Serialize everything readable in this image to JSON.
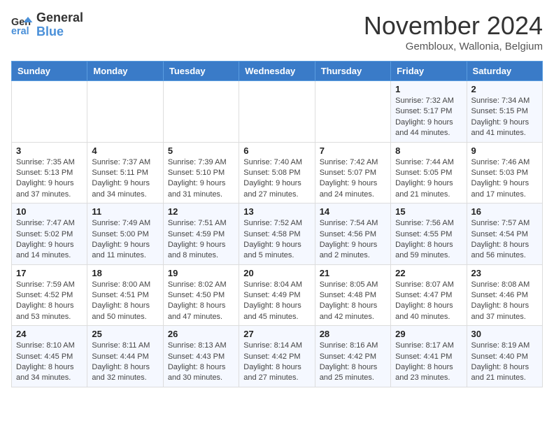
{
  "logo": {
    "text_general": "General",
    "text_blue": "Blue"
  },
  "header": {
    "month_year": "November 2024",
    "location": "Gembloux, Wallonia, Belgium"
  },
  "weekdays": [
    "Sunday",
    "Monday",
    "Tuesday",
    "Wednesday",
    "Thursday",
    "Friday",
    "Saturday"
  ],
  "weeks": [
    [
      {
        "day": "",
        "info": ""
      },
      {
        "day": "",
        "info": ""
      },
      {
        "day": "",
        "info": ""
      },
      {
        "day": "",
        "info": ""
      },
      {
        "day": "",
        "info": ""
      },
      {
        "day": "1",
        "info": "Sunrise: 7:32 AM\nSunset: 5:17 PM\nDaylight: 9 hours\nand 44 minutes."
      },
      {
        "day": "2",
        "info": "Sunrise: 7:34 AM\nSunset: 5:15 PM\nDaylight: 9 hours\nand 41 minutes."
      }
    ],
    [
      {
        "day": "3",
        "info": "Sunrise: 7:35 AM\nSunset: 5:13 PM\nDaylight: 9 hours\nand 37 minutes."
      },
      {
        "day": "4",
        "info": "Sunrise: 7:37 AM\nSunset: 5:11 PM\nDaylight: 9 hours\nand 34 minutes."
      },
      {
        "day": "5",
        "info": "Sunrise: 7:39 AM\nSunset: 5:10 PM\nDaylight: 9 hours\nand 31 minutes."
      },
      {
        "day": "6",
        "info": "Sunrise: 7:40 AM\nSunset: 5:08 PM\nDaylight: 9 hours\nand 27 minutes."
      },
      {
        "day": "7",
        "info": "Sunrise: 7:42 AM\nSunset: 5:07 PM\nDaylight: 9 hours\nand 24 minutes."
      },
      {
        "day": "8",
        "info": "Sunrise: 7:44 AM\nSunset: 5:05 PM\nDaylight: 9 hours\nand 21 minutes."
      },
      {
        "day": "9",
        "info": "Sunrise: 7:46 AM\nSunset: 5:03 PM\nDaylight: 9 hours\nand 17 minutes."
      }
    ],
    [
      {
        "day": "10",
        "info": "Sunrise: 7:47 AM\nSunset: 5:02 PM\nDaylight: 9 hours\nand 14 minutes."
      },
      {
        "day": "11",
        "info": "Sunrise: 7:49 AM\nSunset: 5:00 PM\nDaylight: 9 hours\nand 11 minutes."
      },
      {
        "day": "12",
        "info": "Sunrise: 7:51 AM\nSunset: 4:59 PM\nDaylight: 9 hours\nand 8 minutes."
      },
      {
        "day": "13",
        "info": "Sunrise: 7:52 AM\nSunset: 4:58 PM\nDaylight: 9 hours\nand 5 minutes."
      },
      {
        "day": "14",
        "info": "Sunrise: 7:54 AM\nSunset: 4:56 PM\nDaylight: 9 hours\nand 2 minutes."
      },
      {
        "day": "15",
        "info": "Sunrise: 7:56 AM\nSunset: 4:55 PM\nDaylight: 8 hours\nand 59 minutes."
      },
      {
        "day": "16",
        "info": "Sunrise: 7:57 AM\nSunset: 4:54 PM\nDaylight: 8 hours\nand 56 minutes."
      }
    ],
    [
      {
        "day": "17",
        "info": "Sunrise: 7:59 AM\nSunset: 4:52 PM\nDaylight: 8 hours\nand 53 minutes."
      },
      {
        "day": "18",
        "info": "Sunrise: 8:00 AM\nSunset: 4:51 PM\nDaylight: 8 hours\nand 50 minutes."
      },
      {
        "day": "19",
        "info": "Sunrise: 8:02 AM\nSunset: 4:50 PM\nDaylight: 8 hours\nand 47 minutes."
      },
      {
        "day": "20",
        "info": "Sunrise: 8:04 AM\nSunset: 4:49 PM\nDaylight: 8 hours\nand 45 minutes."
      },
      {
        "day": "21",
        "info": "Sunrise: 8:05 AM\nSunset: 4:48 PM\nDaylight: 8 hours\nand 42 minutes."
      },
      {
        "day": "22",
        "info": "Sunrise: 8:07 AM\nSunset: 4:47 PM\nDaylight: 8 hours\nand 40 minutes."
      },
      {
        "day": "23",
        "info": "Sunrise: 8:08 AM\nSunset: 4:46 PM\nDaylight: 8 hours\nand 37 minutes."
      }
    ],
    [
      {
        "day": "24",
        "info": "Sunrise: 8:10 AM\nSunset: 4:45 PM\nDaylight: 8 hours\nand 34 minutes."
      },
      {
        "day": "25",
        "info": "Sunrise: 8:11 AM\nSunset: 4:44 PM\nDaylight: 8 hours\nand 32 minutes."
      },
      {
        "day": "26",
        "info": "Sunrise: 8:13 AM\nSunset: 4:43 PM\nDaylight: 8 hours\nand 30 minutes."
      },
      {
        "day": "27",
        "info": "Sunrise: 8:14 AM\nSunset: 4:42 PM\nDaylight: 8 hours\nand 27 minutes."
      },
      {
        "day": "28",
        "info": "Sunrise: 8:16 AM\nSunset: 4:42 PM\nDaylight: 8 hours\nand 25 minutes."
      },
      {
        "day": "29",
        "info": "Sunrise: 8:17 AM\nSunset: 4:41 PM\nDaylight: 8 hours\nand 23 minutes."
      },
      {
        "day": "30",
        "info": "Sunrise: 8:19 AM\nSunset: 4:40 PM\nDaylight: 8 hours\nand 21 minutes."
      }
    ]
  ]
}
